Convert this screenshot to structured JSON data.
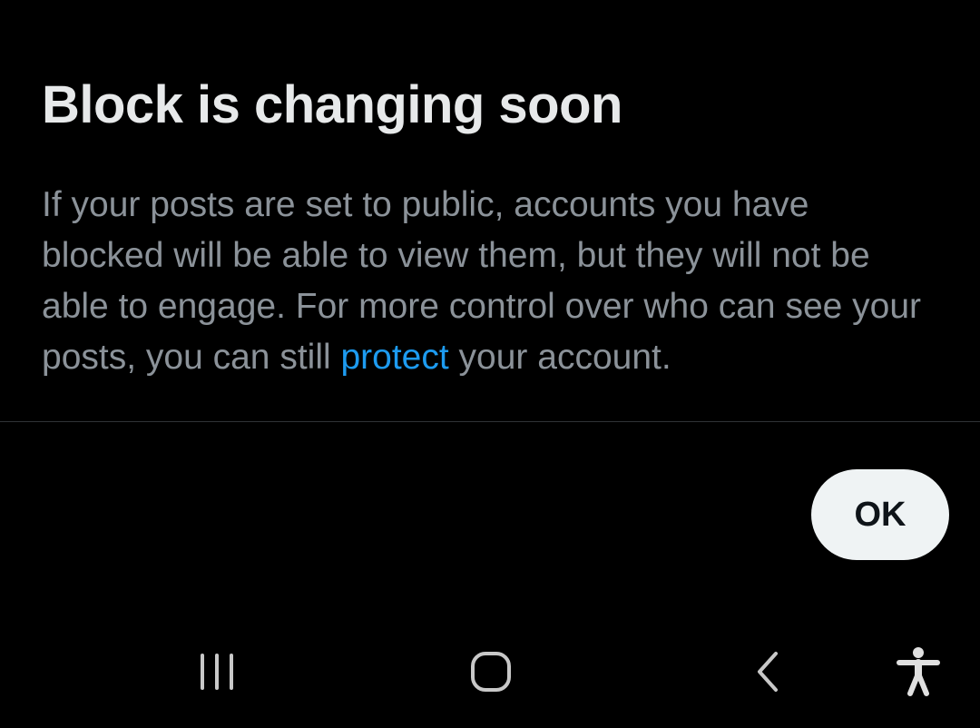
{
  "dialog": {
    "title": "Block is changing soon",
    "body_before_link": "If your posts are set to public, accounts you have blocked will be able to view them, but they will not be able to engage. For more control over who can see your posts, you can still ",
    "link_text": "protect",
    "body_after_link": " your account.",
    "ok_label": "OK"
  },
  "navbar": {
    "recents_icon": "recents-icon",
    "home_icon": "home-icon",
    "back_icon": "back-icon",
    "accessibility_icon": "accessibility-icon"
  },
  "colors": {
    "background": "#000000",
    "title": "#e7e9ea",
    "body": "#8b9299",
    "link": "#1d9bf0",
    "button_bg": "#eff3f4",
    "button_text": "#0f1419"
  }
}
